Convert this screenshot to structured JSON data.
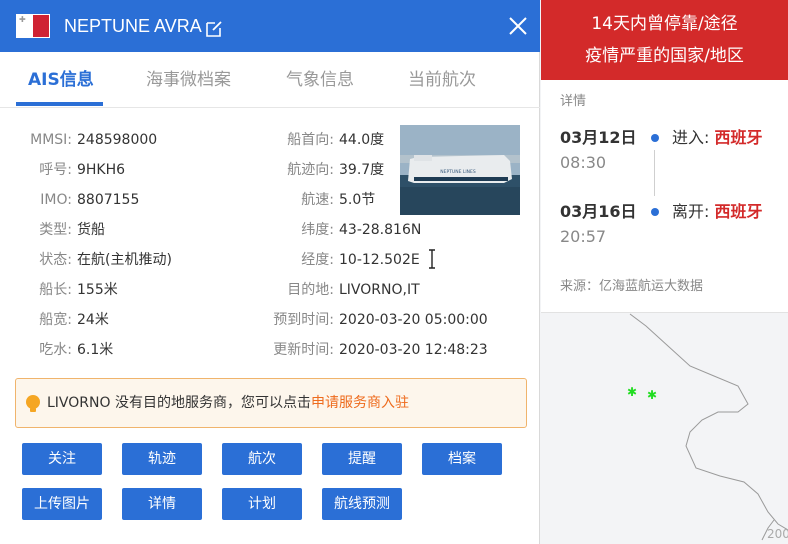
{
  "colors": {
    "primary": "#2b6fd6",
    "danger": "#d32a2a",
    "link": "#ee6b1d"
  },
  "ship": {
    "name": "NEPTUNE AVRA",
    "flag": "Malta",
    "photo_text": "NEPTUNE LINES"
  },
  "tabs": [
    {
      "label": "AIS信息",
      "active": true
    },
    {
      "label": "海事微档案",
      "active": false
    },
    {
      "label": "气象信息",
      "active": false
    },
    {
      "label": "当前航次",
      "active": false
    }
  ],
  "info_left": [
    {
      "label": "MMSI:",
      "value": "248598000"
    },
    {
      "label": "呼号:",
      "value": "9HKH6"
    },
    {
      "label": "IMO:",
      "value": "8807155"
    },
    {
      "label": "类型:",
      "value": "货船"
    },
    {
      "label": "状态:",
      "value": "在航(主机推动)"
    },
    {
      "label": "船长:",
      "value": "155米"
    },
    {
      "label": "船宽:",
      "value": "24米"
    },
    {
      "label": "吃水:",
      "value": "6.1米"
    }
  ],
  "info_right": [
    {
      "label": "船首向:",
      "value": "44.0度"
    },
    {
      "label": "航迹向:",
      "value": "39.7度"
    },
    {
      "label": "航速:",
      "value": "5.0节"
    },
    {
      "label": "纬度:",
      "value": "43-28.816N"
    },
    {
      "label": "经度:",
      "value": "10-12.502E"
    },
    {
      "label": "目的地:",
      "value": "LIVORNO,IT"
    },
    {
      "label": "预到时间:",
      "value": "2020-03-20 05:00:00"
    },
    {
      "label": "更新时间:",
      "value": "2020-03-20 12:48:23"
    }
  ],
  "notice": {
    "text": "LIVORNO 没有目的地服务商，您可以点击",
    "link": "申请服务商入驻"
  },
  "buttons": [
    {
      "label": "关注"
    },
    {
      "label": "轨迹"
    },
    {
      "label": "航次"
    },
    {
      "label": "提醒"
    },
    {
      "label": "档案"
    },
    {
      "label": "上传图片"
    },
    {
      "label": "详情"
    },
    {
      "label": "计划"
    },
    {
      "label": "航线预测"
    }
  ],
  "epidemic": {
    "title_line1": "14天内曾停靠/途径",
    "title_line2": "疫情严重的国家/地区",
    "subtitle": "详情",
    "events": [
      {
        "date": "03月12日",
        "time": "08:30",
        "action": "进入:",
        "country": "西班牙"
      },
      {
        "date": "03月16日",
        "time": "20:57",
        "action": "离开:",
        "country": "西班牙"
      }
    ],
    "source": "来源：亿海蓝航运大数据"
  },
  "map": {
    "corner_label": "200"
  }
}
